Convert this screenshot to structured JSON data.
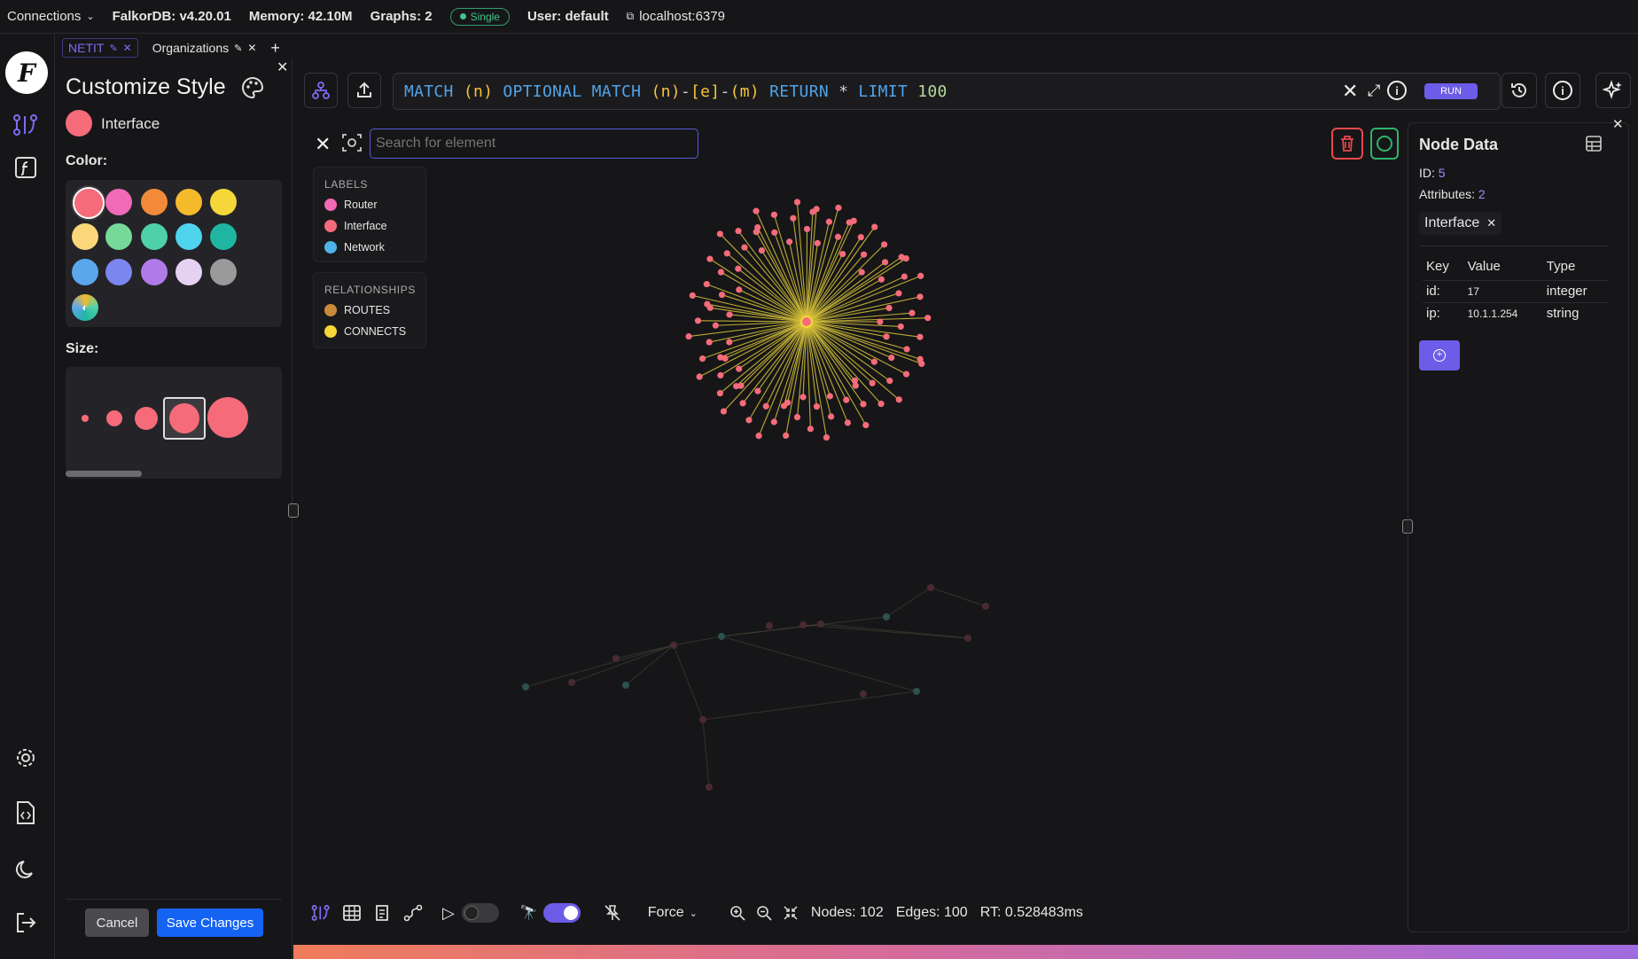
{
  "topbar": {
    "connections": "Connections",
    "version": "FalkorDB: v4.20.01",
    "memory": "Memory: 42.10M",
    "graphs": "Graphs: 2",
    "mode": "Single",
    "user": "User: default",
    "host": "localhost:6379"
  },
  "tabs": [
    {
      "label": "NETIT",
      "active": true
    },
    {
      "label": "Organizations",
      "active": false
    }
  ],
  "style_panel": {
    "title": "Customize Style",
    "selected_label": "Interface",
    "selected_color": "#f56b7a",
    "color_heading": "Color:",
    "size_heading": "Size:",
    "colors": [
      "#f56b7a",
      "#f06ab7",
      "#f28a3a",
      "#f5b92c",
      "#f5d73a",
      "#fbd77a",
      "#76d99a",
      "#4fd1a8",
      "#4fd3ef",
      "#1fb5a1",
      "#5aa7ec",
      "#7b86ee",
      "#b07ae8",
      "#e5d2f2",
      "#9a9a9a"
    ],
    "custom_color_icon": "palette-icon",
    "cancel": "Cancel",
    "save": "Save Changes"
  },
  "query": {
    "text_tokens": [
      {
        "t": "MATCH ",
        "c": "#4fa3e8"
      },
      {
        "t": "(n) ",
        "c": "#f5c33b"
      },
      {
        "t": "OPTIONAL MATCH ",
        "c": "#4fa3e8"
      },
      {
        "t": "(n)",
        "c": "#f5c33b"
      },
      {
        "t": "-",
        "c": "#cfcfcf"
      },
      {
        "t": "[e]",
        "c": "#f5c33b"
      },
      {
        "t": "-",
        "c": "#cfcfcf"
      },
      {
        "t": "(m) ",
        "c": "#f5c33b"
      },
      {
        "t": "RETURN ",
        "c": "#4fa3e8"
      },
      {
        "t": "* ",
        "c": "#cfcfcf"
      },
      {
        "t": "LIMIT ",
        "c": "#4fa3e8"
      },
      {
        "t": "100",
        "c": "#b5d89a"
      }
    ],
    "run": "RUN"
  },
  "search": {
    "placeholder": "Search for element"
  },
  "legend": {
    "labels_heading": "LABELS",
    "labels": [
      {
        "name": "Router",
        "color": "#f06ab7"
      },
      {
        "name": "Interface",
        "color": "#f56b7a"
      },
      {
        "name": "Network",
        "color": "#4fb3e8"
      }
    ],
    "relationships_heading": "RELATIONSHIPS",
    "relationships": [
      {
        "name": "ROUTES",
        "color": "#c98a3a"
      },
      {
        "name": "CONNECTS",
        "color": "#f5d73a"
      }
    ]
  },
  "node_data": {
    "title": "Node Data",
    "id_label": "ID:",
    "id_value": "5",
    "attributes_label": "Attributes:",
    "attributes_value": "2",
    "label_chip": "Interface",
    "headers": [
      "Key",
      "Value",
      "Type"
    ],
    "rows": [
      {
        "key": "id:",
        "value": "17",
        "type": "integer"
      },
      {
        "key": "ip:",
        "value": "10.1.1.254",
        "type": "string"
      }
    ]
  },
  "bottombar": {
    "layout": "Force",
    "nodes": "Nodes: 102",
    "edges": "Edges: 100",
    "rt": "RT: 0.528483ms"
  }
}
